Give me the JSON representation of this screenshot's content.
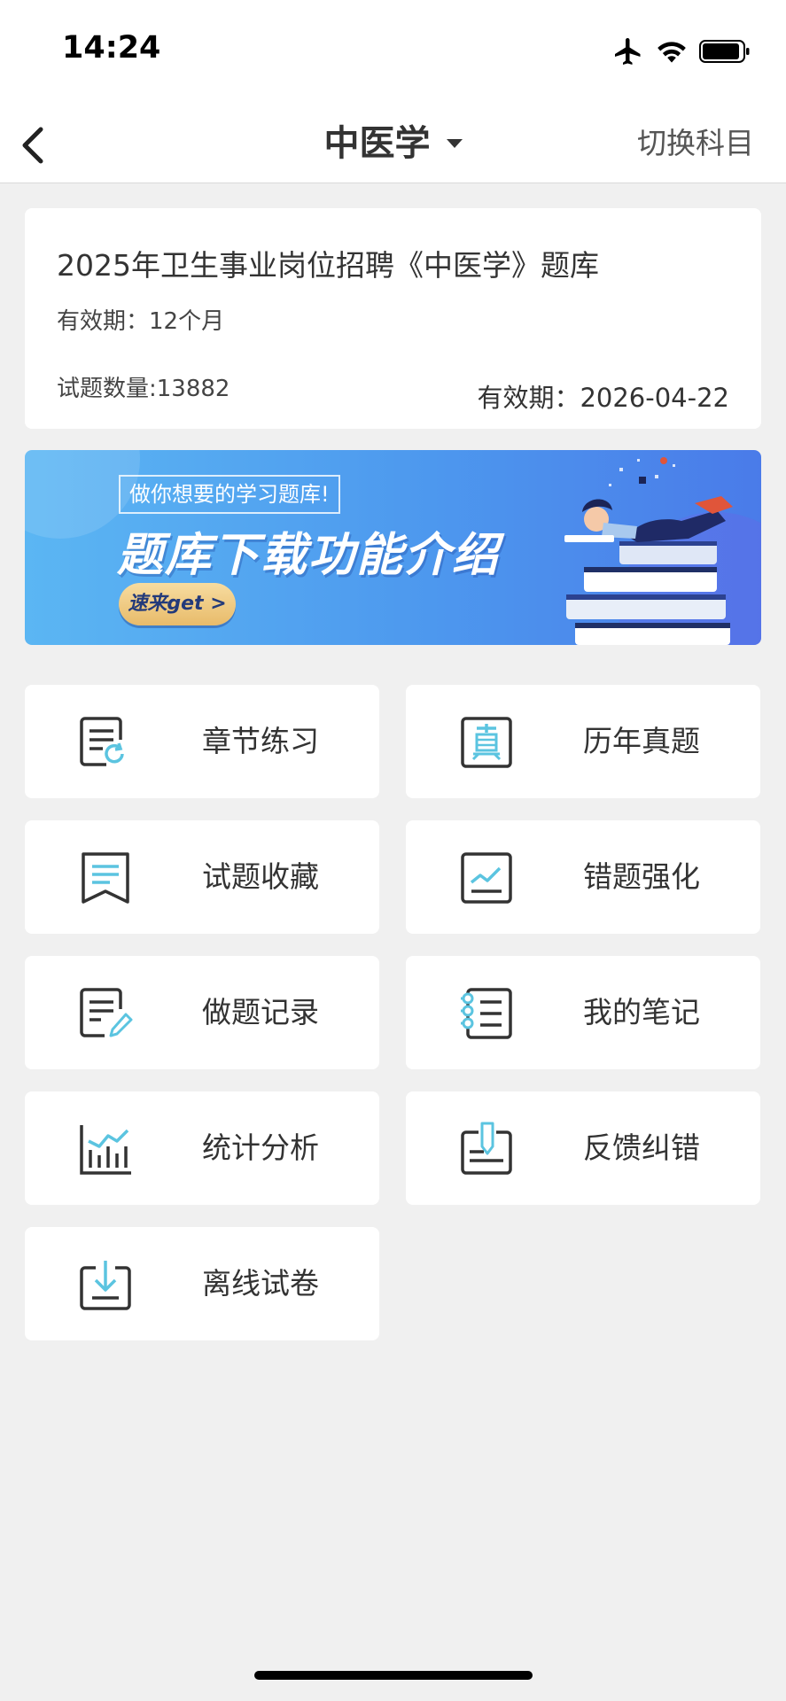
{
  "status_bar": {
    "time": "14:24"
  },
  "nav": {
    "title": "中医学",
    "switch_label": "切换科目"
  },
  "card": {
    "title": "2025年卫生事业岗位招聘《中医学》题库",
    "validity": "有效期：12个月",
    "count": "试题数量:13882",
    "expire": "有效期：2026-04-22"
  },
  "banner": {
    "subtitle": "做你想要的学习题库!",
    "title": "题库下载功能介绍",
    "button": "速来get >"
  },
  "menu": [
    {
      "label": "章节练习",
      "icon": "chapter-practice-icon"
    },
    {
      "label": "历年真题",
      "icon": "past-exams-icon"
    },
    {
      "label": "试题收藏",
      "icon": "bookmark-icon"
    },
    {
      "label": "错题强化",
      "icon": "mistake-review-icon"
    },
    {
      "label": "做题记录",
      "icon": "record-icon"
    },
    {
      "label": "我的笔记",
      "icon": "notebook-icon"
    },
    {
      "label": "统计分析",
      "icon": "statistics-icon"
    },
    {
      "label": "反馈纠错",
      "icon": "feedback-icon"
    },
    {
      "label": "离线试卷",
      "icon": "download-icon"
    }
  ],
  "colors": {
    "accent": "#5bc4e0",
    "icon_dark": "#333333",
    "background": "#f0f0f0"
  }
}
